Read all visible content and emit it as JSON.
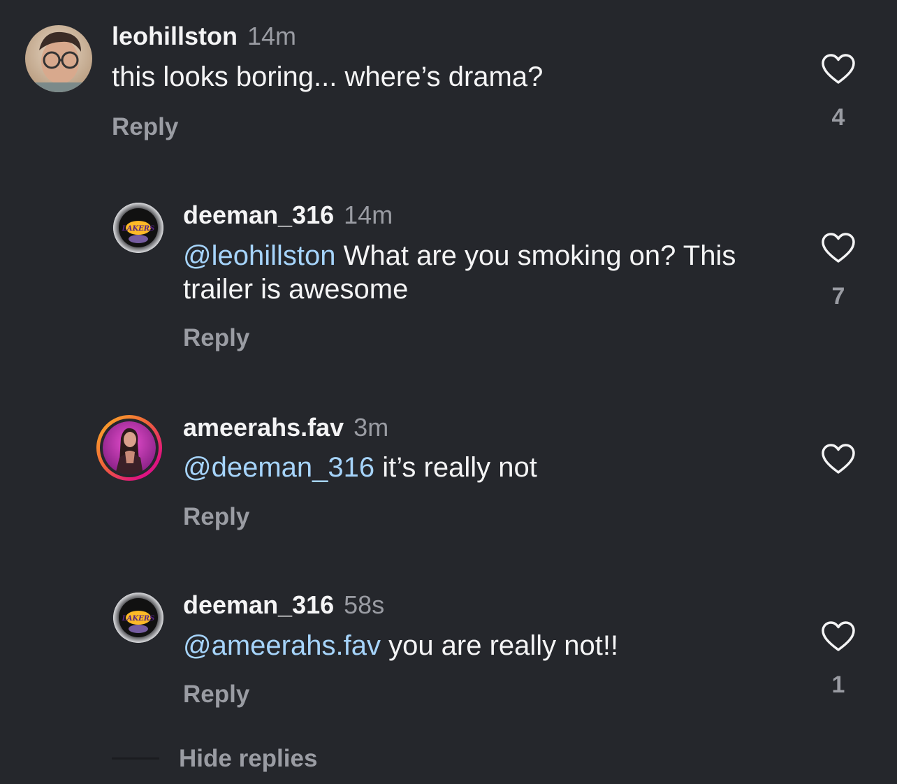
{
  "comments": [
    {
      "username": "leohillston",
      "time": "14m",
      "mention": "",
      "text": "this looks boring... where’s drama?",
      "reply_label": "Reply",
      "like_count": "4"
    },
    {
      "username": "deeman_316",
      "time": "14m",
      "mention": "@leohillston",
      "text": " What are you smoking on? This trailer is awesome",
      "reply_label": "Reply",
      "like_count": "7"
    },
    {
      "username": "ameerahs.fav",
      "time": "3m",
      "mention": "@deeman_316",
      "text": " it’s really not",
      "reply_label": "Reply",
      "like_count": ""
    },
    {
      "username": "deeman_316",
      "time": "58s",
      "mention": "@ameerahs.fav",
      "text": " you are really not!!",
      "reply_label": "Reply",
      "like_count": "1"
    }
  ],
  "footer": {
    "hide_replies_label": "Hide replies"
  },
  "avatars": {
    "lakers_logo_text": "LAKERS"
  },
  "colors": {
    "background": "#25272c",
    "text_primary": "#f4f4f5",
    "text_secondary": "#9a9ca3",
    "mention": "#a6d4fb",
    "story_ring_start": "#fdb424",
    "story_ring_end": "#e1137f"
  }
}
